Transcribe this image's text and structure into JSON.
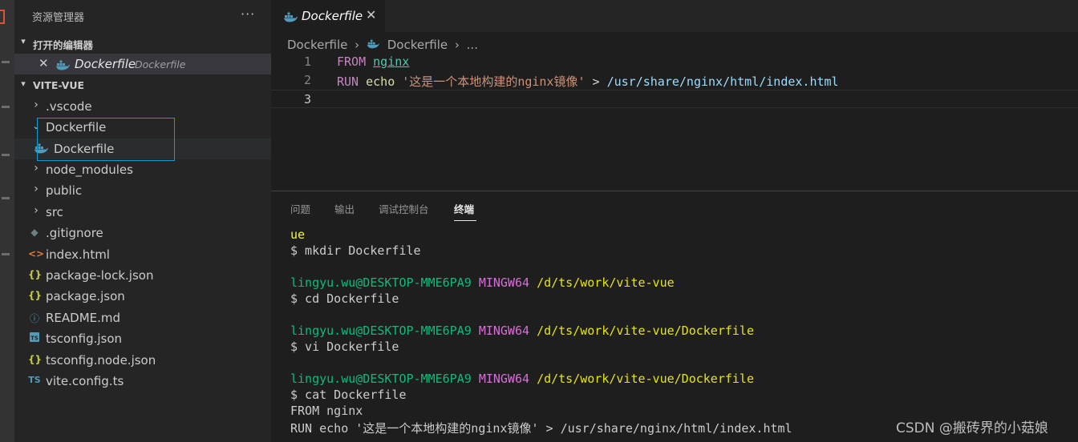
{
  "colors": {
    "accent_focus": "#0e9bd8",
    "docker_icon": "#519aba",
    "json_icon": "#cbcb41",
    "html_icon": "#e37933",
    "info_icon": "#519aba",
    "ts_icon": "#519aba",
    "terminal_user": "#23d18b",
    "terminal_shell": "#d670d6",
    "terminal_path": "#e5e510"
  },
  "sidebar": {
    "title": "资源管理器",
    "more": "···",
    "open_editors": {
      "label": "打开的编辑器",
      "items": [
        {
          "name": "Dockerfile",
          "description": "Dockerfile",
          "icon": "docker-icon"
        }
      ]
    },
    "project": {
      "label": "VITE-VUE",
      "items": [
        {
          "name": ".vscode",
          "type": "folder",
          "expanded": false
        },
        {
          "name": "Dockerfile",
          "type": "folder",
          "expanded": true
        },
        {
          "name": "Dockerfile",
          "type": "file",
          "icon": "docker-icon"
        },
        {
          "name": "node_modules",
          "type": "folder",
          "expanded": false
        },
        {
          "name": "public",
          "type": "folder",
          "expanded": false
        },
        {
          "name": "src",
          "type": "folder",
          "expanded": false
        },
        {
          "name": ".gitignore",
          "type": "file",
          "icon": "git-icon"
        },
        {
          "name": "index.html",
          "type": "file",
          "icon": "html-icon"
        },
        {
          "name": "package-lock.json",
          "type": "file",
          "icon": "json-icon"
        },
        {
          "name": "package.json",
          "type": "file",
          "icon": "json-icon"
        },
        {
          "name": "README.md",
          "type": "file",
          "icon": "info-icon"
        },
        {
          "name": "tsconfig.json",
          "type": "file",
          "icon": "tsconfig-icon"
        },
        {
          "name": "tsconfig.node.json",
          "type": "file",
          "icon": "json-icon"
        },
        {
          "name": "vite.config.ts",
          "type": "file",
          "icon": "ts-icon"
        }
      ]
    }
  },
  "editor": {
    "tab": {
      "name": "Dockerfile",
      "close": "✕"
    },
    "breadcrumb": {
      "first": "Dockerfile",
      "second": "Dockerfile",
      "sep": "›",
      "ellipsis": "..."
    },
    "lines": [
      {
        "number": "1",
        "keyword": "FROM",
        "arg": "nginx"
      },
      {
        "number": "2",
        "keyword": "RUN",
        "cmd": "echo",
        "string": "'这是一个本地构建的nginx镜像'",
        "redirect": ">",
        "path": "/usr/share/nginx/html/index.html"
      },
      {
        "number": "3"
      }
    ]
  },
  "panel": {
    "tabs": [
      "问题",
      "输出",
      "调试控制台",
      "终端"
    ],
    "active_tab": "终端",
    "terminal": {
      "line_ue": "ue",
      "cmd1": "$ mkdir Dockerfile",
      "user": "lingyu.wu@DESKTOP-MME6PA9",
      "shell": "MINGW64",
      "path1": "/d/ts/work/vite-vue",
      "cmd2": "$ cd Dockerfile",
      "path2": "/d/ts/work/vite-vue/Dockerfile",
      "cmd3": "$ vi Dockerfile",
      "cmd4": "$ cat Dockerfile",
      "out1": "FROM nginx",
      "out2": "RUN echo '这是一个本地构建的nginx镜像' > /usr/share/nginx/html/index.html"
    }
  },
  "watermark": "CSDN @搬砖界的小菇娘"
}
